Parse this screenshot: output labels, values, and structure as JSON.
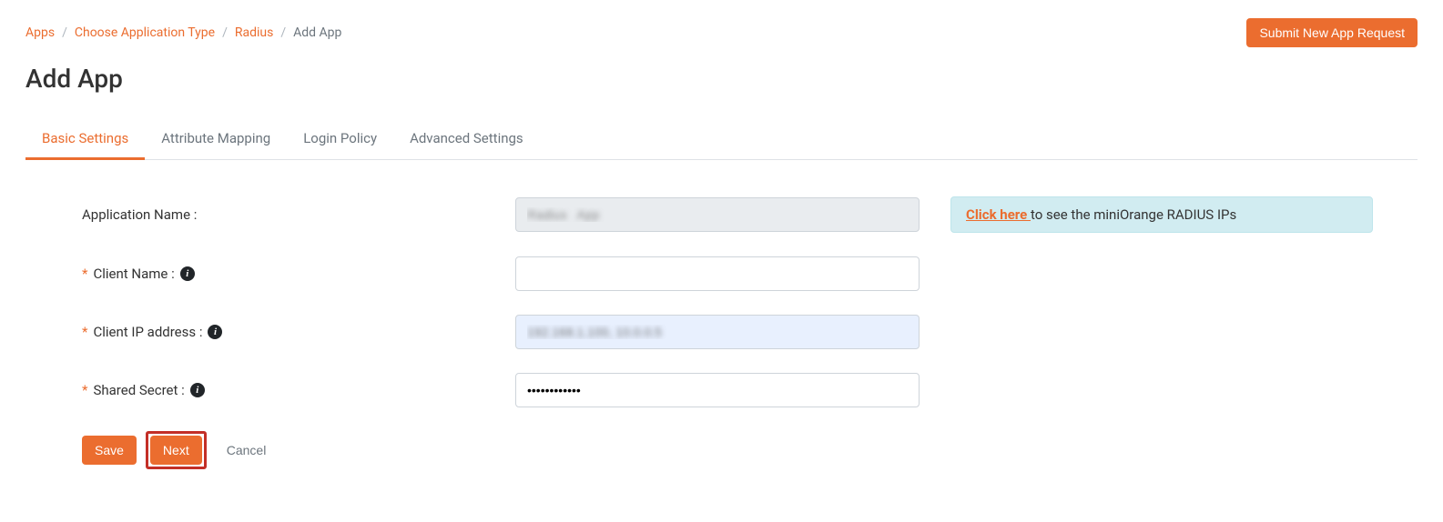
{
  "breadcrumb": {
    "items": [
      {
        "label": "Apps",
        "link": true
      },
      {
        "label": "Choose Application Type",
        "link": true
      },
      {
        "label": "Radius",
        "link": true
      },
      {
        "label": "Add App",
        "link": false
      }
    ]
  },
  "header": {
    "submit_button": "Submit New App Request",
    "page_title": "Add App"
  },
  "tabs": [
    {
      "label": "Basic Settings",
      "active": true
    },
    {
      "label": "Attribute Mapping",
      "active": false
    },
    {
      "label": "Login Policy",
      "active": false
    },
    {
      "label": "Advanced Settings",
      "active": false
    }
  ],
  "form": {
    "app_name_label": "Application Name :",
    "app_name_value": "Radius   App",
    "client_name_label": "Client Name :",
    "client_name_value": "",
    "client_ip_label": "Client IP address :",
    "client_ip_value": "192.168.1.100, 10.0.0.5",
    "shared_secret_label": "Shared Secret :",
    "shared_secret_value": "••••••••••••"
  },
  "info_panel": {
    "link_text": "Click here ",
    "rest_text": "to see the miniOrange RADIUS IPs"
  },
  "buttons": {
    "save": "Save",
    "next": "Next",
    "cancel": "Cancel"
  }
}
